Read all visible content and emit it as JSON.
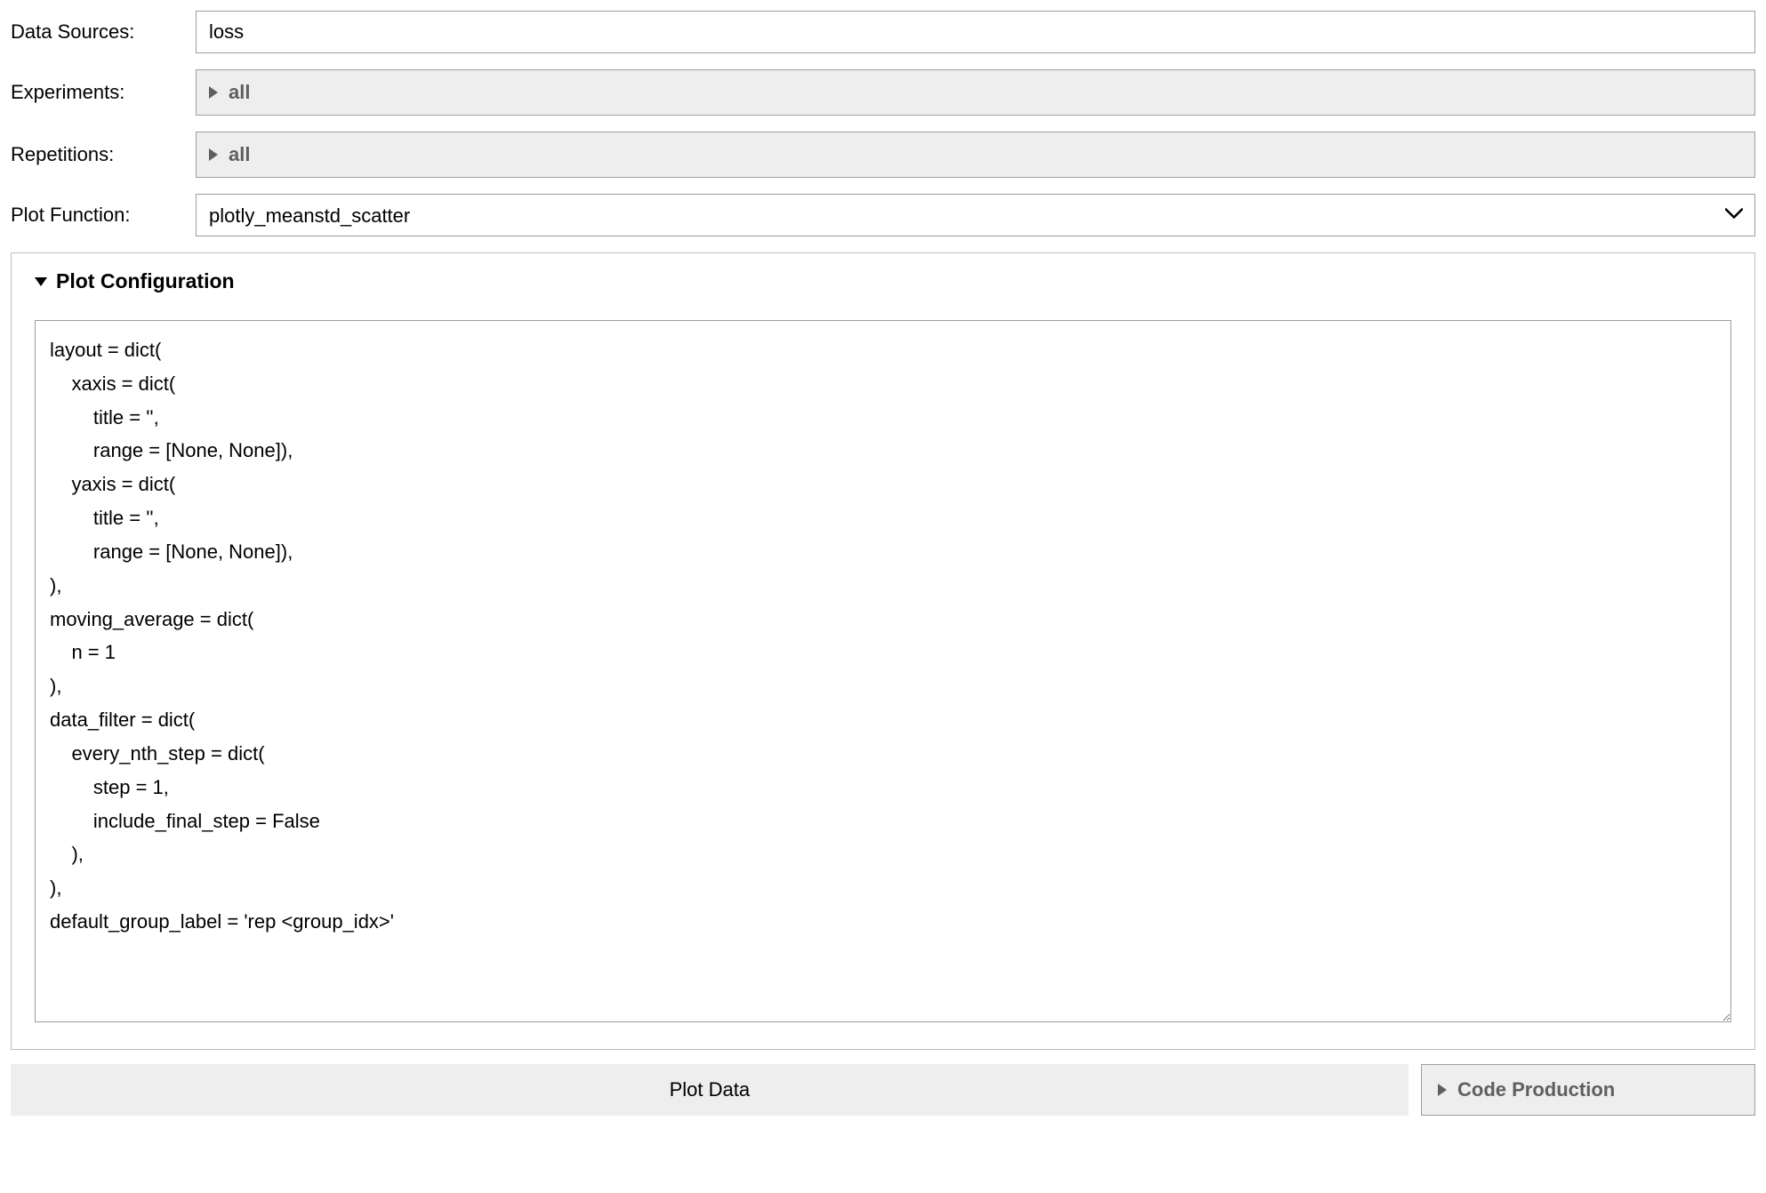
{
  "labels": {
    "data_sources": "Data Sources:",
    "experiments": "Experiments:",
    "repetitions": "Repetitions:",
    "plot_function": "Plot Function:"
  },
  "fields": {
    "data_sources_value": "loss",
    "experiments_value": "all",
    "repetitions_value": "all",
    "plot_function_value": "plotly_meanstd_scatter"
  },
  "config": {
    "title": "Plot Configuration",
    "code": "layout = dict(\n    xaxis = dict(\n        title = '',\n        range = [None, None]),\n    yaxis = dict(\n        title = '',\n        range = [None, None]),\n),\nmoving_average = dict(\n    n = 1\n),\ndata_filter = dict(\n    every_nth_step = dict(\n        step = 1,\n        include_final_step = False\n    ),\n),\ndefault_group_label = 'rep <group_idx>'"
  },
  "buttons": {
    "plot_data": "Plot Data",
    "code_production": "Code Production"
  }
}
